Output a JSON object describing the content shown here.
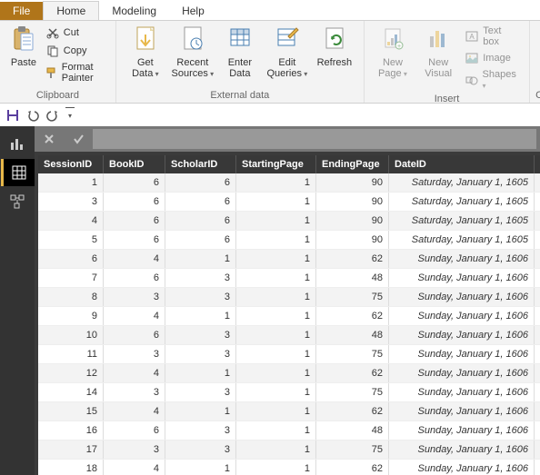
{
  "menu": {
    "file": "File",
    "home": "Home",
    "modeling": "Modeling",
    "help": "Help"
  },
  "ribbon": {
    "clipboard": {
      "label": "Clipboard",
      "paste": "Paste",
      "cut": "Cut",
      "copy": "Copy",
      "format_painter": "Format Painter"
    },
    "external": {
      "label": "External data",
      "get_data": "Get\nData",
      "recent_sources": "Recent\nSources",
      "enter_data": "Enter\nData",
      "edit_queries": "Edit\nQueries",
      "refresh": "Refresh"
    },
    "insert": {
      "label": "Insert",
      "new_page": "New\nPage",
      "new_visual": "New\nVisual",
      "textbox": "Text box",
      "image": "Image",
      "shapes": "Shapes"
    }
  },
  "columns": [
    "SessionID",
    "BookID",
    "ScholarID",
    "StartingPage",
    "EndingPage",
    "DateID"
  ],
  "rows": [
    [
      "1",
      "6",
      "6",
      "1",
      "90",
      "Saturday, January 1, 1605"
    ],
    [
      "3",
      "6",
      "6",
      "1",
      "90",
      "Saturday, January 1, 1605"
    ],
    [
      "4",
      "6",
      "6",
      "1",
      "90",
      "Saturday, January 1, 1605"
    ],
    [
      "5",
      "6",
      "6",
      "1",
      "90",
      "Saturday, January 1, 1605"
    ],
    [
      "6",
      "4",
      "1",
      "1",
      "62",
      "Sunday, January 1, 1606"
    ],
    [
      "7",
      "6",
      "3",
      "1",
      "48",
      "Sunday, January 1, 1606"
    ],
    [
      "8",
      "3",
      "3",
      "1",
      "75",
      "Sunday, January 1, 1606"
    ],
    [
      "9",
      "4",
      "1",
      "1",
      "62",
      "Sunday, January 1, 1606"
    ],
    [
      "10",
      "6",
      "3",
      "1",
      "48",
      "Sunday, January 1, 1606"
    ],
    [
      "11",
      "3",
      "3",
      "1",
      "75",
      "Sunday, January 1, 1606"
    ],
    [
      "12",
      "4",
      "1",
      "1",
      "62",
      "Sunday, January 1, 1606"
    ],
    [
      "14",
      "3",
      "3",
      "1",
      "75",
      "Sunday, January 1, 1606"
    ],
    [
      "15",
      "4",
      "1",
      "1",
      "62",
      "Sunday, January 1, 1606"
    ],
    [
      "16",
      "6",
      "3",
      "1",
      "48",
      "Sunday, January 1, 1606"
    ],
    [
      "17",
      "3",
      "3",
      "1",
      "75",
      "Sunday, January 1, 1606"
    ],
    [
      "18",
      "4",
      "1",
      "1",
      "62",
      "Sunday, January 1, 1606"
    ]
  ]
}
